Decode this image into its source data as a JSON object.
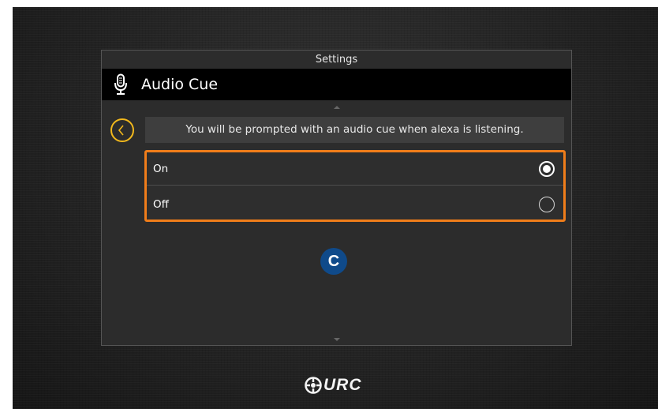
{
  "screen": {
    "settings_title": "Settings",
    "header_title": "Audio Cue",
    "prompt": "You will be prompted with an audio cue when alexa is listening."
  },
  "options": [
    {
      "label": "On",
      "selected": true
    },
    {
      "label": "Off",
      "selected": false
    }
  ],
  "callout": {
    "label": "C",
    "color": "#0f4a8a"
  },
  "brand": {
    "logo_text": "URC"
  },
  "icons": {
    "header": "microphone-icon",
    "back": "back-arrow-icon",
    "scroll_up": "scroll-up-icon",
    "scroll_down": "scroll-down-icon"
  },
  "colors": {
    "accent_back": "#f2b81c",
    "highlight_border": "#f07d1a",
    "header_bg": "#000000"
  }
}
